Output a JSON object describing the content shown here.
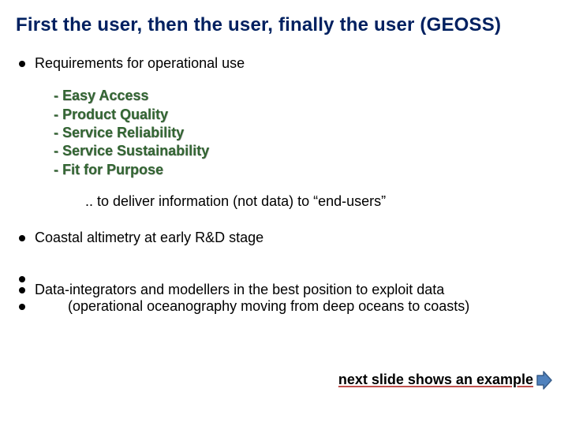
{
  "title": "First the user, then the user, finally the user (GEOSS)",
  "section1": {
    "heading": "Requirements for operational use",
    "items": [
      "- Easy Access",
      "- Product Quality",
      "- Service Reliability",
      "- Service Sustainability",
      "- Fit for Purpose"
    ],
    "deliver": ".. to deliver information (not data) to “end-users”"
  },
  "section2": {
    "heading": "Coastal altimetry at early R&D stage"
  },
  "section3": {
    "line1": "Data-integrators and modellers in the best position to exploit data",
    "line2": "(operational oceanography moving from deep oceans to coasts)"
  },
  "next_slide": "next slide shows an example",
  "colors": {
    "title": "#002060",
    "requirements": "#336633",
    "arrow_stroke": "#385d8a",
    "arrow_fill": "#4f81bd"
  }
}
